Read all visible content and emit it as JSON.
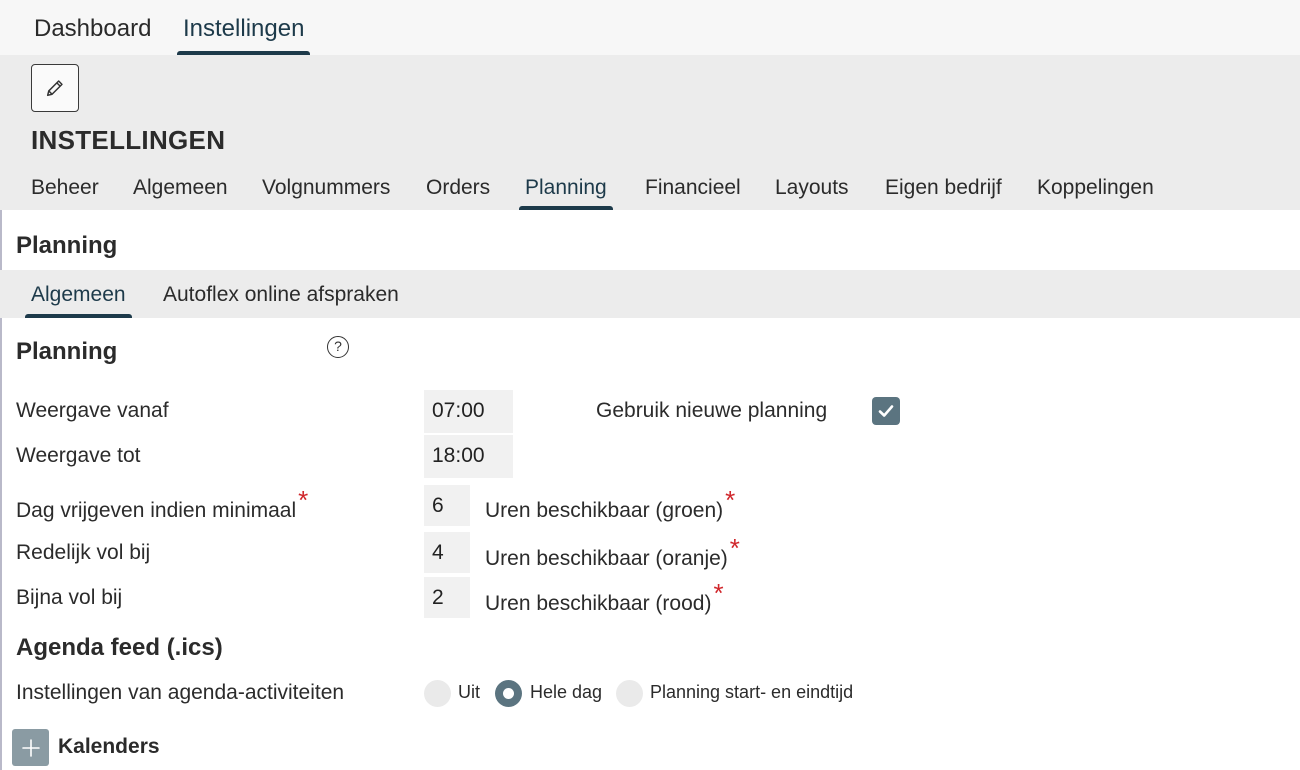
{
  "top_tabs": [
    {
      "label": "Dashboard",
      "active": false
    },
    {
      "label": "Instellingen",
      "active": true
    }
  ],
  "header": {
    "edit_icon": "pencil-icon",
    "title": "INSTELLINGEN",
    "tabs": [
      {
        "label": "Beheer"
      },
      {
        "label": "Algemeen"
      },
      {
        "label": "Volgnummers"
      },
      {
        "label": "Orders"
      },
      {
        "label": "Planning",
        "active": true
      },
      {
        "label": "Financieel"
      },
      {
        "label": "Layouts"
      },
      {
        "label": "Eigen bedrijf"
      },
      {
        "label": "Koppelingen"
      }
    ]
  },
  "section_title": "Planning",
  "inner_tabs": [
    {
      "label": "Algemeen",
      "active": true
    },
    {
      "label": "Autoflex online afspraken"
    }
  ],
  "planning": {
    "title": "Planning",
    "help_icon": "?",
    "weergave_vanaf": {
      "label": "Weergave vanaf",
      "value": "07:00"
    },
    "weergave_tot": {
      "label": "Weergave tot",
      "value": "18:00"
    },
    "nieuwe_planning": {
      "label": "Gebruik nieuwe planning",
      "checked": true
    },
    "dag_vrijgeven": {
      "label": "Dag vrijgeven indien minimaal",
      "value": "6",
      "suffix": "Uren beschikbaar (groen)"
    },
    "redelijk_vol": {
      "label": "Redelijk vol bij",
      "value": "4",
      "suffix": "Uren beschikbaar (oranje)"
    },
    "bijna_vol": {
      "label": "Bijna vol bij",
      "value": "2",
      "suffix": "Uren beschikbaar (rood)"
    },
    "required_mark": "*"
  },
  "agenda": {
    "title": "Agenda feed (.ics)",
    "label": "Instellingen van agenda-activiteiten",
    "options": [
      {
        "label": "Uit",
        "checked": false
      },
      {
        "label": "Hele dag",
        "checked": true
      },
      {
        "label": "Planning start- en eindtijd",
        "checked": false
      }
    ]
  },
  "kalenders": {
    "label": "Kalenders",
    "icon": "plus-icon"
  },
  "colors": {
    "accent": "#1d3a4a",
    "control": "#5b7480",
    "required": "#d0262b"
  }
}
